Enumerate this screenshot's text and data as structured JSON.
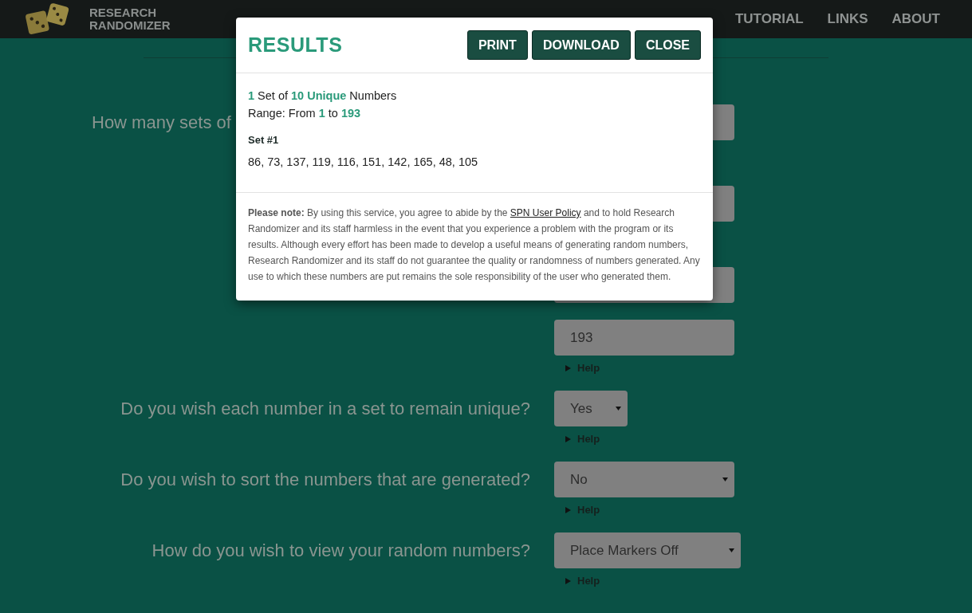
{
  "header": {
    "logo_lines": [
      "RESEARCH",
      "RANDOMIZER"
    ],
    "nav": [
      "TUTORIAL",
      "LINKS",
      "ABOUT"
    ]
  },
  "form": {
    "rows": [
      {
        "kind": "input",
        "label": "How many sets of"
      },
      {
        "kind": "input"
      },
      {
        "kind": "input"
      },
      {
        "kind": "input",
        "value": "193",
        "help": "Help"
      },
      {
        "kind": "select",
        "label": "Do you wish each number in a set to remain unique?",
        "value": "Yes",
        "help": "Help"
      },
      {
        "kind": "select",
        "label": "Do you wish to sort the numbers that are generated?",
        "value": "No",
        "help": "Help"
      },
      {
        "kind": "select",
        "label": "How do you wish to view your random numbers?",
        "value": "Place Markers Off",
        "help": "Help"
      }
    ]
  },
  "modal": {
    "title": "RESULTS",
    "buttons": [
      "PRINT",
      "DOWNLOAD",
      "CLOSE"
    ],
    "summary": [
      "**1** Set of **10 Unique** Numbers",
      "Range: From **1** to **193**"
    ],
    "set_title": "Set #1",
    "numbers": "86, 73, 137, 119, 116, 151, 142, 165, 48, 105",
    "note": {
      "lead": "Please note:",
      "before": "By using this service, you agree to abide by the",
      "link": "SPN User Policy",
      "after": "and to hold Research Randomizer and its staff harmless in the event that you experience a problem with the program or its results. Although every effort has been made to develop a useful means of generating random numbers, Research Randomizer and its staff do not guarantee the quality or randomness of numbers generated. Any use to which these numbers are put remains the sole responsibility of the user who generated them."
    }
  }
}
